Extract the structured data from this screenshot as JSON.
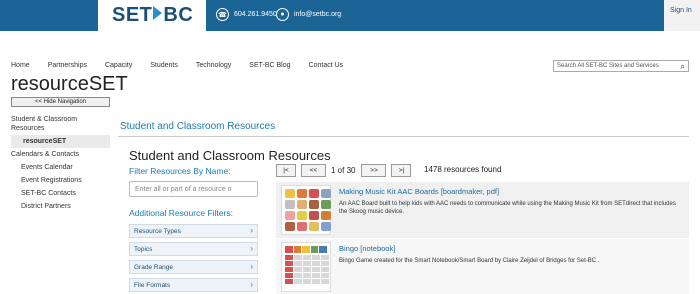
{
  "header": {
    "logo_left": "SET",
    "logo_right": "BC",
    "phone": "604.261.9450",
    "email": "info@setbc.org",
    "signin": "Sign In",
    "phone_icon": "phone-icon",
    "user_icon": "user-icon"
  },
  "nav": {
    "items": [
      "Home",
      "Partnerships",
      "Capacity",
      "Students",
      "Technology",
      "SET-BC Blog",
      "Contact Us"
    ],
    "search_placeholder": "Search All SET-BC Sites and Services"
  },
  "site_title": "resourceSET",
  "hide_nav": "<< Hide Navigation",
  "sidebar": {
    "items": [
      "Student & Classroom Resources",
      "resourceSET",
      "Calendars & Contacts",
      "Events Calendar",
      "Event Registrations",
      "SET-BC Contacts",
      "District Partners"
    ]
  },
  "main": {
    "heading": "Student and Classroom Resources",
    "page_title": "Student and Classroom Resources",
    "filter_label": "Filter Resources By Name:",
    "filter_placeholder": "Enter all or part of a resource n",
    "additional_label": "Additional Resource Filters:",
    "filters": [
      "Resource Types",
      "Topics",
      "Grade Range",
      "File Formats"
    ]
  },
  "pager": {
    "first": "|<",
    "prev": "<<",
    "page_text": "1 of 30",
    "next": ">>",
    "last": ">|",
    "count": "1478 resources found"
  },
  "results": [
    {
      "title": "Making Music Kit AAC Boards [boardmaker, pdf]",
      "desc": "An AAC Board built to help kids with AAC needs to communicate while using the Making Music Kit from SETdirect that includes the Skoog music device."
    },
    {
      "title": "Bingo [notebook]",
      "desc": "Bingo Game created for the Smart Notebook/Smart Board by Claire Zeijdel of Bridges for Set-BC ."
    }
  ],
  "colors": {
    "brand_blue": "#1a6496",
    "link_blue": "#1a7bb5"
  }
}
